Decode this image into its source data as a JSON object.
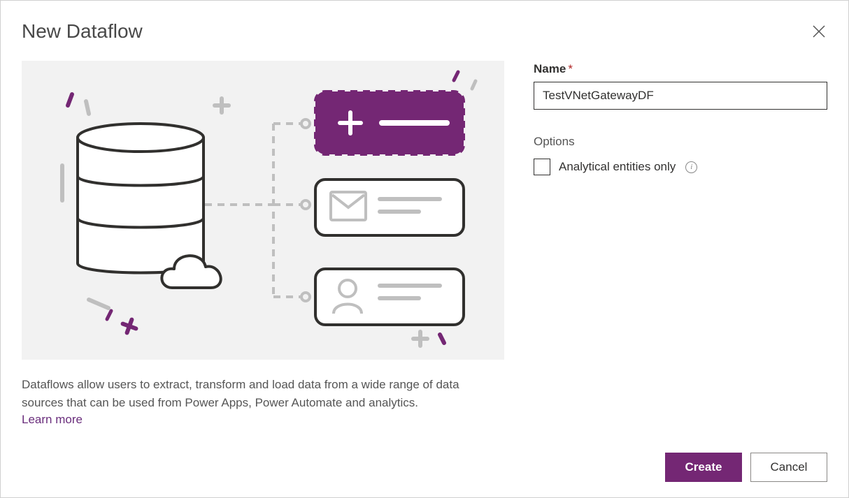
{
  "header": {
    "title": "New Dataflow"
  },
  "left": {
    "description": "Dataflows allow users to extract, transform and load data from a wide range of data sources that can be used from Power Apps, Power Automate and analytics.",
    "learn_more": "Learn more"
  },
  "form": {
    "name_label": "Name",
    "name_value": "TestVNetGatewayDF",
    "options_heading": "Options",
    "analytical_label": "Analytical entities only"
  },
  "footer": {
    "create": "Create",
    "cancel": "Cancel"
  },
  "colors": {
    "accent": "#742774",
    "illustration_bg": "#f2f2f2"
  }
}
